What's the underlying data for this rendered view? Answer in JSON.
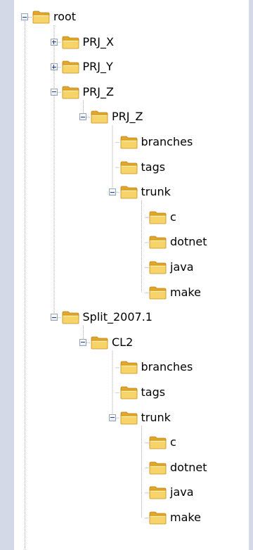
{
  "tree": {
    "items": [
      {
        "label": "root",
        "depth": 0,
        "toggle": "expanded",
        "icon": "folder-icon"
      },
      {
        "label": "PRJ_X",
        "depth": 1,
        "toggle": "collapsed",
        "icon": "folder-icon"
      },
      {
        "label": "PRJ_Y",
        "depth": 1,
        "toggle": "collapsed",
        "icon": "folder-icon"
      },
      {
        "label": "PRJ_Z",
        "depth": 1,
        "toggle": "expanded",
        "icon": "folder-icon"
      },
      {
        "label": "PRJ_Z",
        "depth": 2,
        "toggle": "expanded",
        "icon": "folder-icon"
      },
      {
        "label": "branches",
        "depth": 3,
        "toggle": "none",
        "icon": "folder-icon"
      },
      {
        "label": "tags",
        "depth": 3,
        "toggle": "none",
        "icon": "folder-icon"
      },
      {
        "label": "trunk",
        "depth": 3,
        "toggle": "expanded",
        "icon": "folder-icon"
      },
      {
        "label": "c",
        "depth": 4,
        "toggle": "none",
        "icon": "folder-icon"
      },
      {
        "label": "dotnet",
        "depth": 4,
        "toggle": "none",
        "icon": "folder-icon"
      },
      {
        "label": "java",
        "depth": 4,
        "toggle": "none",
        "icon": "folder-icon"
      },
      {
        "label": "make",
        "depth": 4,
        "toggle": "none",
        "icon": "folder-icon"
      },
      {
        "label": "Split_2007.1",
        "depth": 1,
        "toggle": "expanded",
        "icon": "folder-icon"
      },
      {
        "label": "CL2",
        "depth": 2,
        "toggle": "expanded",
        "icon": "folder-icon"
      },
      {
        "label": "branches",
        "depth": 3,
        "toggle": "none",
        "icon": "folder-icon"
      },
      {
        "label": "tags",
        "depth": 3,
        "toggle": "none",
        "icon": "folder-icon"
      },
      {
        "label": "trunk",
        "depth": 3,
        "toggle": "expanded",
        "icon": "folder-icon"
      },
      {
        "label": "c",
        "depth": 4,
        "toggle": "none",
        "icon": "folder-icon"
      },
      {
        "label": "dotnet",
        "depth": 4,
        "toggle": "none",
        "icon": "folder-icon"
      },
      {
        "label": "java",
        "depth": 4,
        "toggle": "none",
        "icon": "folder-icon"
      },
      {
        "label": "make",
        "depth": 4,
        "toggle": "none",
        "icon": "folder-icon"
      }
    ]
  },
  "colors": {
    "background": "#d3d9e6",
    "panel": "#ffffff",
    "tree_line": "#a0a0a0",
    "folder_body": "#f6cf5a",
    "folder_dark": "#d79c1b"
  }
}
